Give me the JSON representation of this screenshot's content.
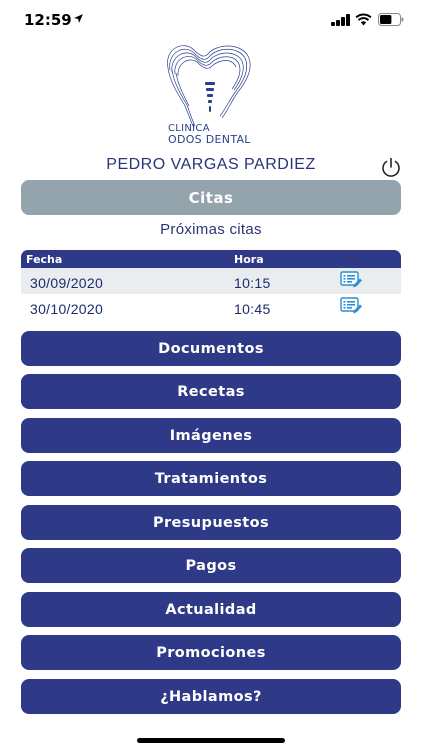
{
  "status_bar": {
    "time": "12:59",
    "battery_level": 0.6
  },
  "logo": {
    "line1": "CLINICA",
    "line2": "ODOS DENTAL"
  },
  "patient": {
    "name": "PEDRO VARGAS PARDIEZ"
  },
  "citas": {
    "label": "Citas",
    "subtitle": "Próximas citas"
  },
  "appointments": {
    "headers": {
      "fecha": "Fecha",
      "hora": "Hora"
    },
    "rows": [
      {
        "fecha": "30/09/2020",
        "hora": "10:15"
      },
      {
        "fecha": "30/10/2020",
        "hora": "10:45"
      }
    ]
  },
  "menu": {
    "documentos": "Documentos",
    "recetas": "Recetas",
    "imagenes": "Imágenes",
    "tratamientos": "Tratamientos",
    "presupuestos": "Presupuestos",
    "pagos": "Pagos",
    "actualidad": "Actualidad",
    "promociones": "Promociones",
    "hablamos": "¿Hablamos?"
  },
  "colors": {
    "primary": "#2e3a87",
    "citas_bg": "#93a4ad",
    "row_alt": "#e9edf0",
    "icon_blue": "#2a8fd0"
  }
}
